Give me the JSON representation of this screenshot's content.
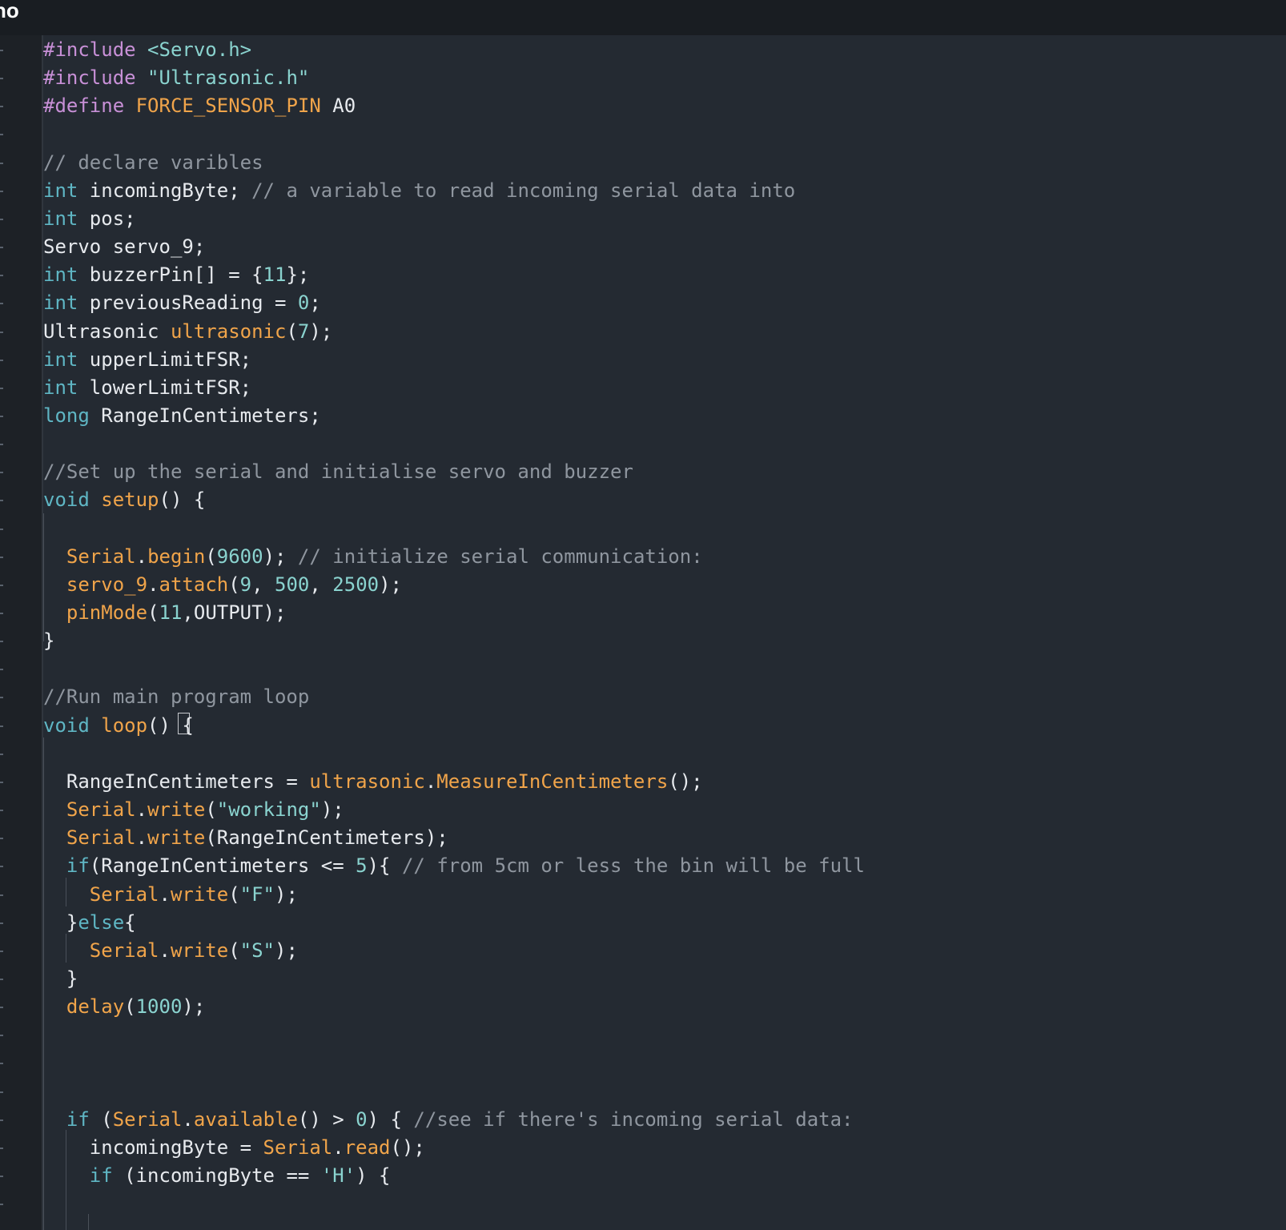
{
  "window": {
    "title": "no"
  },
  "code_lines": [
    [
      [
        "pp",
        "#include"
      ],
      [
        "pl",
        " "
      ],
      [
        "str",
        "<Servo.h>"
      ]
    ],
    [
      [
        "pp",
        "#include"
      ],
      [
        "pl",
        " "
      ],
      [
        "str",
        "\"Ultrasonic.h\""
      ]
    ],
    [
      [
        "pp",
        "#define"
      ],
      [
        "pl",
        " "
      ],
      [
        "fn",
        "FORCE_SENSOR_PIN"
      ],
      [
        "pl",
        " A0"
      ]
    ],
    [],
    [
      [
        "cm",
        "// declare varibles"
      ]
    ],
    [
      [
        "kw",
        "int"
      ],
      [
        "pl",
        " incomingByte; "
      ],
      [
        "cm",
        "// a variable to read incoming serial data into"
      ]
    ],
    [
      [
        "kw",
        "int"
      ],
      [
        "pl",
        " pos;"
      ]
    ],
    [
      [
        "pl",
        "Servo servo_9;"
      ]
    ],
    [
      [
        "kw",
        "int"
      ],
      [
        "pl",
        " buzzerPin[] = {"
      ],
      [
        "num",
        "11"
      ],
      [
        "pl",
        "};"
      ]
    ],
    [
      [
        "kw",
        "int"
      ],
      [
        "pl",
        " previousReading = "
      ],
      [
        "num",
        "0"
      ],
      [
        "pl",
        ";"
      ]
    ],
    [
      [
        "pl",
        "Ultrasonic "
      ],
      [
        "fn",
        "ultrasonic"
      ],
      [
        "pl",
        "("
      ],
      [
        "num",
        "7"
      ],
      [
        "pl",
        ");"
      ]
    ],
    [
      [
        "kw",
        "int"
      ],
      [
        "pl",
        " upperLimitFSR;"
      ]
    ],
    [
      [
        "kw",
        "int"
      ],
      [
        "pl",
        " lowerLimitFSR;"
      ]
    ],
    [
      [
        "kw",
        "long"
      ],
      [
        "pl",
        " RangeInCentimeters;"
      ]
    ],
    [],
    [
      [
        "cm",
        "//Set up the serial and initialise servo and buzzer"
      ]
    ],
    [
      [
        "kw",
        "void"
      ],
      [
        "pl",
        " "
      ],
      [
        "fn",
        "setup"
      ],
      [
        "pl",
        "() {"
      ]
    ],
    [],
    [
      [
        "pl",
        "  "
      ],
      [
        "fn",
        "Serial"
      ],
      [
        "pl",
        "."
      ],
      [
        "fn",
        "begin"
      ],
      [
        "pl",
        "("
      ],
      [
        "num",
        "9600"
      ],
      [
        "pl",
        "); "
      ],
      [
        "cm",
        "// initialize serial communication:"
      ]
    ],
    [
      [
        "pl",
        "  "
      ],
      [
        "fn",
        "servo_9"
      ],
      [
        "pl",
        "."
      ],
      [
        "fn",
        "attach"
      ],
      [
        "pl",
        "("
      ],
      [
        "num",
        "9"
      ],
      [
        "pl",
        ", "
      ],
      [
        "num",
        "500"
      ],
      [
        "pl",
        ", "
      ],
      [
        "num",
        "2500"
      ],
      [
        "pl",
        ");"
      ]
    ],
    [
      [
        "pl",
        "  "
      ],
      [
        "fn",
        "pinMode"
      ],
      [
        "pl",
        "("
      ],
      [
        "num",
        "11"
      ],
      [
        "pl",
        ",OUTPUT);"
      ]
    ],
    [
      [
        "pl",
        "}"
      ]
    ],
    [],
    [
      [
        "cm",
        "//Run main program loop"
      ]
    ],
    [
      [
        "kw",
        "void"
      ],
      [
        "pl",
        " "
      ],
      [
        "fn",
        "loop"
      ],
      [
        "pl",
        "() {"
      ]
    ],
    [],
    [
      [
        "pl",
        "  RangeInCentimeters = "
      ],
      [
        "fn",
        "ultrasonic"
      ],
      [
        "pl",
        "."
      ],
      [
        "fn",
        "MeasureInCentimeters"
      ],
      [
        "pl",
        "();"
      ]
    ],
    [
      [
        "pl",
        "  "
      ],
      [
        "fn",
        "Serial"
      ],
      [
        "pl",
        "."
      ],
      [
        "fn",
        "write"
      ],
      [
        "pl",
        "("
      ],
      [
        "str",
        "\"working\""
      ],
      [
        "pl",
        ");"
      ]
    ],
    [
      [
        "pl",
        "  "
      ],
      [
        "fn",
        "Serial"
      ],
      [
        "pl",
        "."
      ],
      [
        "fn",
        "write"
      ],
      [
        "pl",
        "(RangeInCentimeters);"
      ]
    ],
    [
      [
        "pl",
        "  "
      ],
      [
        "kw",
        "if"
      ],
      [
        "pl",
        "(RangeInCentimeters <= "
      ],
      [
        "num",
        "5"
      ],
      [
        "pl",
        "){ "
      ],
      [
        "cm",
        "// from 5cm or less the bin will be full"
      ]
    ],
    [
      [
        "pl",
        "    "
      ],
      [
        "fn",
        "Serial"
      ],
      [
        "pl",
        "."
      ],
      [
        "fn",
        "write"
      ],
      [
        "pl",
        "("
      ],
      [
        "str",
        "\"F\""
      ],
      [
        "pl",
        ");"
      ]
    ],
    [
      [
        "pl",
        "  }"
      ],
      [
        "kw",
        "else"
      ],
      [
        "pl",
        "{"
      ]
    ],
    [
      [
        "pl",
        "    "
      ],
      [
        "fn",
        "Serial"
      ],
      [
        "pl",
        "."
      ],
      [
        "fn",
        "write"
      ],
      [
        "pl",
        "("
      ],
      [
        "str",
        "\"S\""
      ],
      [
        "pl",
        ");"
      ]
    ],
    [
      [
        "pl",
        "  }"
      ]
    ],
    [
      [
        "pl",
        "  "
      ],
      [
        "fn",
        "delay"
      ],
      [
        "pl",
        "("
      ],
      [
        "num",
        "1000"
      ],
      [
        "pl",
        ");"
      ]
    ],
    [],
    [],
    [],
    [
      [
        "pl",
        "  "
      ],
      [
        "kw",
        "if"
      ],
      [
        "pl",
        " ("
      ],
      [
        "fn",
        "Serial"
      ],
      [
        "pl",
        "."
      ],
      [
        "fn",
        "available"
      ],
      [
        "pl",
        "() > "
      ],
      [
        "num",
        "0"
      ],
      [
        "pl",
        ") { "
      ],
      [
        "cm",
        "//see if there's incoming serial data:"
      ]
    ],
    [
      [
        "pl",
        "    incomingByte = "
      ],
      [
        "fn",
        "Serial"
      ],
      [
        "pl",
        "."
      ],
      [
        "fn",
        "read"
      ],
      [
        "pl",
        "();"
      ]
    ],
    [
      [
        "pl",
        "    "
      ],
      [
        "kw",
        "if"
      ],
      [
        "pl",
        " (incomingByte == "
      ],
      [
        "str",
        "'H'"
      ],
      [
        "pl",
        ") {"
      ]
    ]
  ]
}
